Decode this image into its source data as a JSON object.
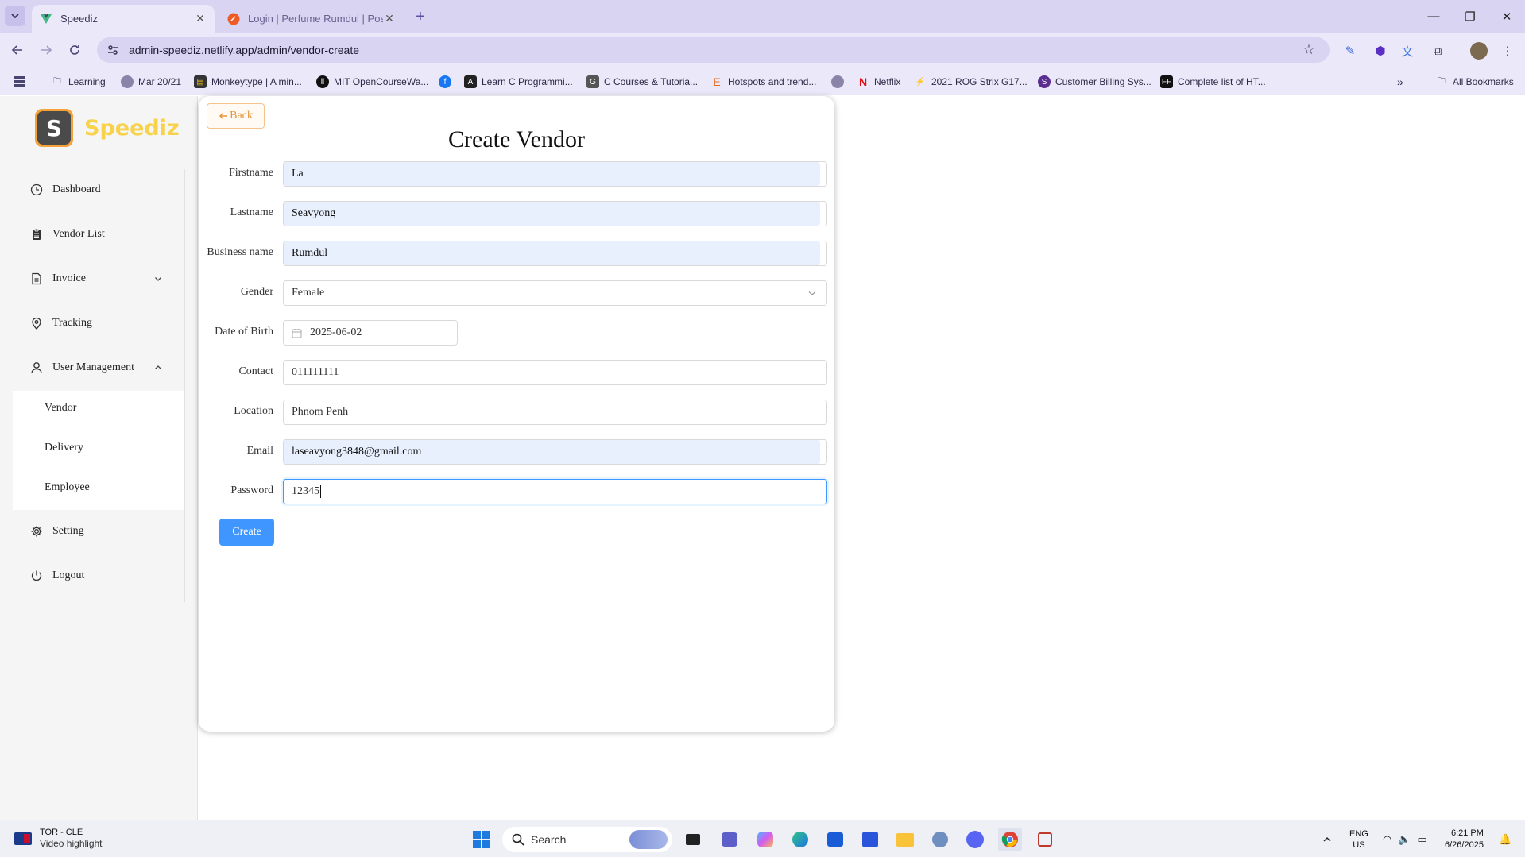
{
  "browser": {
    "tabs": [
      {
        "title": "Speediz",
        "active": true
      },
      {
        "title": "Login | Perfume Rumdul | Postm",
        "active": false
      }
    ],
    "url": "admin-speediz.netlify.app/admin/vendor-create",
    "bookmarks": [
      {
        "label": "Learning",
        "icon": "folder-icon"
      },
      {
        "label": "Mar 20/21",
        "icon": "globe-icon"
      },
      {
        "label": "Monkeytype | A min...",
        "icon": "monkeytype-icon"
      },
      {
        "label": "MIT OpenCourseWa...",
        "icon": "mit-icon"
      },
      {
        "label": "",
        "icon": "facebook-icon"
      },
      {
        "label": "Learn C Programmi...",
        "icon": "learn-c-icon"
      },
      {
        "label": "C Courses & Tutoria...",
        "icon": "c-courses-icon"
      },
      {
        "label": "Hotspots and trend...",
        "icon": "hotspots-icon"
      },
      {
        "label": "",
        "icon": "globe-icon"
      },
      {
        "label": "Netflix",
        "icon": "netflix-icon"
      },
      {
        "label": "2021 ROG Strix G17...",
        "icon": "rog-icon"
      },
      {
        "label": "Customer Billing Sys...",
        "icon": "billing-icon"
      },
      {
        "label": "Complete list of HT...",
        "icon": "ff-icon"
      }
    ],
    "all_bookmarks": "All Bookmarks"
  },
  "sidebar": {
    "brand": "Speediz",
    "logo_letter": "S",
    "items": [
      {
        "label": "Dashboard",
        "icon": "clock-icon"
      },
      {
        "label": "Vendor List",
        "icon": "list-icon"
      },
      {
        "label": "Invoice",
        "icon": "document-icon"
      },
      {
        "label": "Tracking",
        "icon": "location-pin-icon"
      },
      {
        "label": "User Management",
        "icon": "user-icon"
      },
      {
        "label": "Setting",
        "icon": "gear-icon"
      },
      {
        "label": "Logout",
        "icon": "power-icon"
      }
    ],
    "submenu": [
      "Vendor",
      "Delivery",
      "Employee"
    ]
  },
  "form": {
    "back_label": "Back",
    "title": "Create Vendor",
    "fields": {
      "firstname": {
        "label": "Firstname",
        "value": "La"
      },
      "lastname": {
        "label": "Lastname",
        "value": "Seavyong"
      },
      "business_name": {
        "label": "Business name",
        "value": "Rumdul"
      },
      "gender": {
        "label": "Gender",
        "value": "Female"
      },
      "dob": {
        "label": "Date of Birth",
        "value": "2025-06-02"
      },
      "contact": {
        "label": "Contact",
        "value": "011111111"
      },
      "location": {
        "label": "Location",
        "value": "Phnom Penh"
      },
      "email": {
        "label": "Email",
        "value": "laseavyong3848@gmail.com"
      },
      "password": {
        "label": "Password",
        "value": "12345"
      }
    },
    "create_label": "Create"
  },
  "taskbar": {
    "widget_title": "TOR - CLE",
    "widget_subtitle": "Video highlight",
    "search_label": "Search",
    "lang1": "ENG",
    "lang2": "US",
    "time": "6:21 PM",
    "date": "6/26/2025"
  },
  "colors": {
    "accent": "#4096ff",
    "brand_yellow": "#f7d24a",
    "brand_orange": "#f6a23a",
    "chrome": "#ebe8fa"
  }
}
